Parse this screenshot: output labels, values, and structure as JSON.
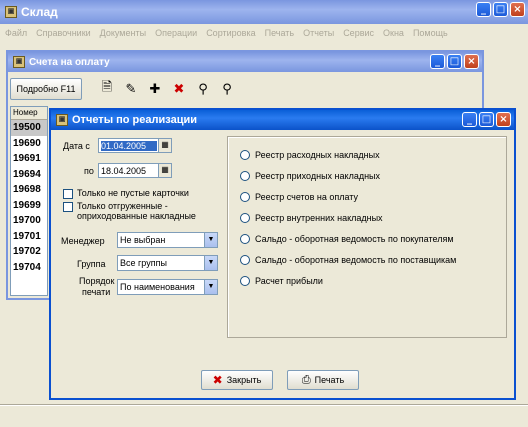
{
  "app": {
    "title": "Склад"
  },
  "menu": [
    "Файл",
    "Справочники",
    "Документы",
    "Операции",
    "Сортировка",
    "Печать",
    "Отчеты",
    "Сервис",
    "Окна",
    "Помощь"
  ],
  "invoices_window": {
    "title": "Счета на оплату",
    "details_button": "Подробно F11",
    "toolbar_icons": [
      "document-icon",
      "edit-icon",
      "new-document-icon",
      "delete-icon",
      "find-icon",
      "find-next-icon"
    ],
    "column_header": "Номер",
    "rows": [
      "19500",
      "19690",
      "19691",
      "19694",
      "19698",
      "19699",
      "19700",
      "19701",
      "19702",
      "19704"
    ]
  },
  "dialog": {
    "title": "Отчеты по реализации",
    "date_from_label": "Дата с",
    "date_from": "01.04.2005",
    "date_to_label": "по",
    "date_to": "18.04.2005",
    "checkbox_nonempty": "Только не пустые карточки",
    "checkbox_shipped": "Только отгруженные - оприходованные накладные",
    "manager_label": "Менеджер",
    "manager_value": "Не выбран",
    "group_label": "Группа",
    "group_value": "Все группы",
    "print_order_label_1": "Порядок",
    "print_order_label_2": "печати",
    "print_order_value": "По наименования",
    "reports": [
      "Реестр расходных накладных",
      "Реестр приходных накладных",
      "Реестр счетов на оплату",
      "Реестр внутренних накладных",
      "Сальдо - оборотная ведомость по покупателям",
      "Сальдо - оборотная ведомость по поставщикам",
      "Расчет прибыли"
    ],
    "close_button": "Закрыть",
    "print_button": "Печать"
  },
  "colors": {
    "titlebar": "#0a5fd8",
    "selected_row": "#c8c8c8",
    "date_highlight": "#316ac5"
  }
}
